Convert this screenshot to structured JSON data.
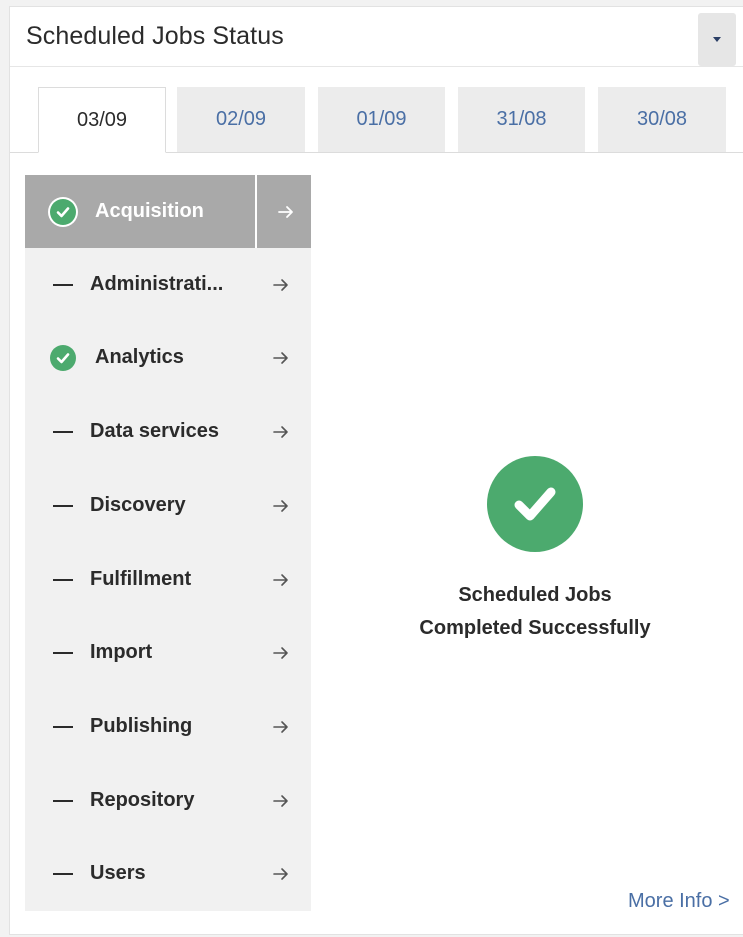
{
  "header": {
    "title": "Scheduled Jobs Status",
    "menu_icon": "caret-down-icon"
  },
  "tabs": [
    {
      "label": "03/09",
      "active": true
    },
    {
      "label": "02/09",
      "active": false
    },
    {
      "label": "01/09",
      "active": false
    },
    {
      "label": "31/08",
      "active": false
    },
    {
      "label": "30/08",
      "active": false
    }
  ],
  "sidebar": {
    "items": [
      {
        "label": "Acquisition",
        "status": "success",
        "active": true
      },
      {
        "label": "Administrati...",
        "status": "none",
        "active": false
      },
      {
        "label": "Analytics",
        "status": "success",
        "active": false
      },
      {
        "label": "Data services",
        "status": "none",
        "active": false
      },
      {
        "label": "Discovery",
        "status": "none",
        "active": false
      },
      {
        "label": "Fulfillment",
        "status": "none",
        "active": false
      },
      {
        "label": "Import",
        "status": "none",
        "active": false
      },
      {
        "label": "Publishing",
        "status": "none",
        "active": false
      },
      {
        "label": "Repository",
        "status": "none",
        "active": false
      },
      {
        "label": "Users",
        "status": "none",
        "active": false
      }
    ]
  },
  "main": {
    "status_icon": "check-circle-icon",
    "message_line1": "Scheduled Jobs",
    "message_line2": "Completed Successfully"
  },
  "footer": {
    "more_info": "More Info >"
  },
  "colors": {
    "success": "#4caa6e",
    "link": "#4a6fa5",
    "active_item_bg": "#a9a9a9",
    "sidebar_bg": "#f1f1f1",
    "tab_bg": "#ececec"
  }
}
